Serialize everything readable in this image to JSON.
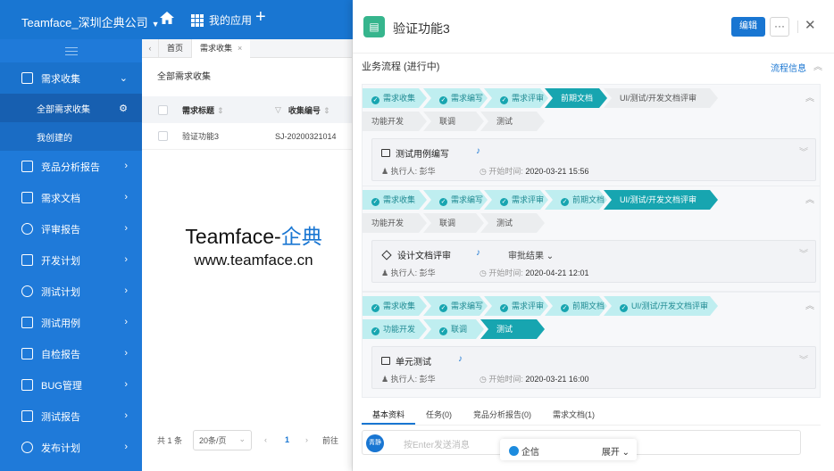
{
  "topbar": {
    "company": "Teamface_深圳企典公司",
    "apps_label": "我的应用"
  },
  "sidebar": {
    "items": [
      {
        "label": "需求收集",
        "icon": "doc-icon",
        "expanded": true,
        "children": [
          {
            "label": "全部需求收集",
            "active": true
          },
          {
            "label": "我创建的",
            "active": false
          }
        ]
      },
      {
        "label": "竞品分析报告",
        "icon": "report-icon"
      },
      {
        "label": "需求文档",
        "icon": "file-icon"
      },
      {
        "label": "评审报告",
        "icon": "review-icon"
      },
      {
        "label": "开发计划",
        "icon": "plan-icon"
      },
      {
        "label": "测试计划",
        "icon": "test-plan-icon"
      },
      {
        "label": "测试用例",
        "icon": "testcase-icon"
      },
      {
        "label": "自检报告",
        "icon": "cart-icon"
      },
      {
        "label": "BUG管理",
        "icon": "bug-icon"
      },
      {
        "label": "测试报告",
        "icon": "test-report-icon"
      },
      {
        "label": "发布计划",
        "icon": "release-icon"
      }
    ]
  },
  "tabs": [
    {
      "label": "首页"
    },
    {
      "label": "需求收集",
      "active": true
    }
  ],
  "list": {
    "title": "全部需求收集",
    "columns": [
      "需求标题",
      "收集编号"
    ],
    "rows": [
      {
        "title": "验证功能3",
        "code": "SJ-20200321014"
      }
    ],
    "pager": {
      "total": "共 1 条",
      "size": "20条/页",
      "page": "1",
      "goto": "前往"
    }
  },
  "watermark": {
    "line1_en": "Teamface-",
    "line1_cn": "企典",
    "line2": "www.teamface.cn"
  },
  "panel": {
    "title": "验证功能3",
    "edit_label": "编辑",
    "more_label": "···",
    "flow_title": "业务流程 (进行中)",
    "flow_info": "流程信息",
    "stages": [
      {
        "steps": [
          {
            "label": "需求收集",
            "state": "done"
          },
          {
            "label": "需求编写",
            "state": "done"
          },
          {
            "label": "需求评审",
            "state": "done"
          },
          {
            "label": "前期文档",
            "state": "cur"
          },
          {
            "label": "UI/测试/开发文档评审",
            "state": "todo"
          },
          {
            "label": "功能开发",
            "state": "todo"
          },
          {
            "label": "联调",
            "state": "todo"
          },
          {
            "label": "测试",
            "state": "todo"
          }
        ],
        "task": {
          "name": "测试用例编写",
          "type": "square",
          "executor": "执行人: 彭华",
          "time_label": "开始时间:",
          "time": "2020-03-21 15:56"
        }
      },
      {
        "steps": [
          {
            "label": "需求收集",
            "state": "done"
          },
          {
            "label": "需求编写",
            "state": "done"
          },
          {
            "label": "需求评审",
            "state": "done"
          },
          {
            "label": "前期文档",
            "state": "done"
          },
          {
            "label": "UI/测试/开发文档评审",
            "state": "cur"
          },
          {
            "label": "功能开发",
            "state": "todo"
          },
          {
            "label": "联调",
            "state": "todo"
          },
          {
            "label": "测试",
            "state": "todo"
          }
        ],
        "task": {
          "name": "设计文档评审",
          "type": "diamond",
          "result": "审批结果",
          "executor": "执行人: 彭华",
          "time_label": "开始时间:",
          "time": "2020-04-21 12:01"
        }
      },
      {
        "steps": [
          {
            "label": "需求收集",
            "state": "done"
          },
          {
            "label": "需求编写",
            "state": "done"
          },
          {
            "label": "需求评审",
            "state": "done"
          },
          {
            "label": "前期文档",
            "state": "done"
          },
          {
            "label": "UI/测试/开发文档评审",
            "state": "done"
          },
          {
            "label": "功能开发",
            "state": "done"
          },
          {
            "label": "联调",
            "state": "done"
          },
          {
            "label": "测试",
            "state": "cur"
          }
        ],
        "task": {
          "name": "单元测试",
          "type": "square",
          "executor": "执行人: 彭华",
          "time_label": "开始时间:",
          "time": "2020-03-21 16:00"
        }
      }
    ],
    "bottom_tabs": [
      "基本资料",
      "任务(0)",
      "竞品分析报告(0)",
      "需求文档(1)"
    ],
    "comment": {
      "avatar": "青静",
      "placeholder": "按Enter发送消息"
    },
    "qiwen": {
      "label": "企信",
      "expand": "展开"
    }
  }
}
